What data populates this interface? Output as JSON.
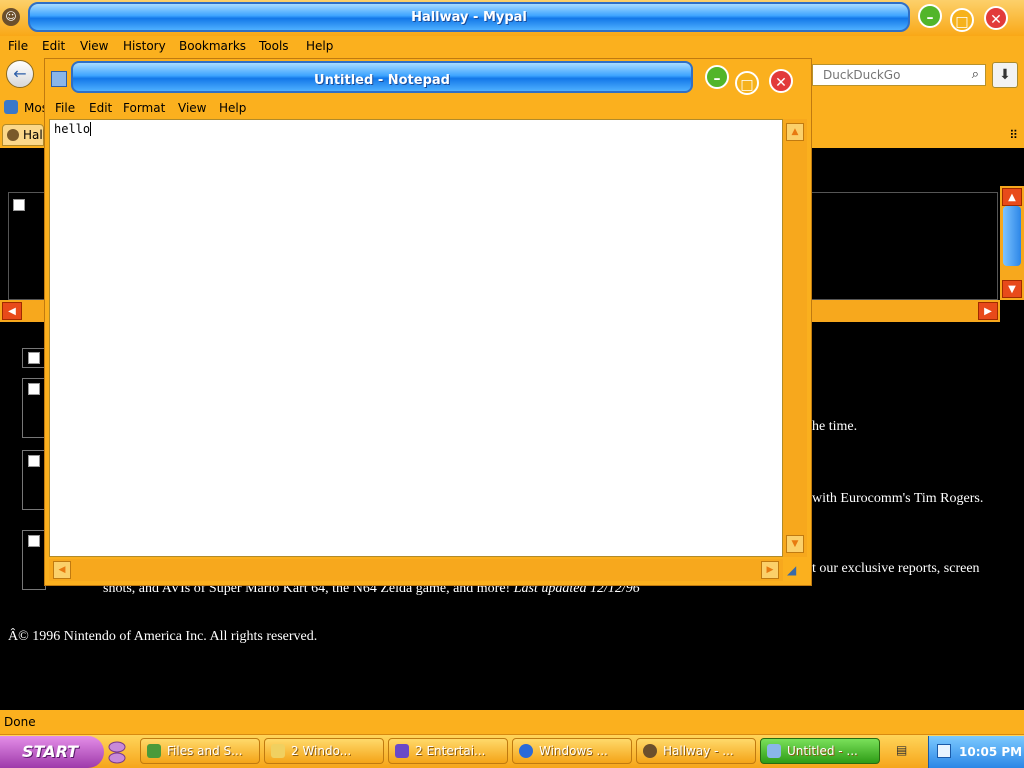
{
  "browser": {
    "title": "Hallway - Mypal",
    "menu": [
      "File",
      "Edit",
      "View",
      "History",
      "Bookmarks",
      "Tools",
      "Help"
    ],
    "search_placeholder": "DuckDuckGo",
    "bookmark_label": "Mos",
    "tab_label": "Hall",
    "status": "Done"
  },
  "page_text": {
    "fragment_time": "he time.",
    "fragment_tim": "with Eurocomm's Tim Rogers.",
    "fragment_reports": "t our exclusive reports, screen",
    "fragment_shots": "shots, and AVIs of Super Mario Kart 64, the N64 Zelda game, and more!",
    "fragment_updated": "Last updated 12/12/96",
    "copyright": "Â© 1996 Nintendo of America Inc. All rights reserved."
  },
  "notepad": {
    "title": "Untitled - Notepad",
    "menu": [
      "File",
      "Edit",
      "Format",
      "View",
      "Help"
    ],
    "content": "hello"
  },
  "taskbar": {
    "start_label": "START",
    "tasks": [
      {
        "label": "Files and S...",
        "icon_color": "#4a9a3a",
        "active": false
      },
      {
        "label": "2 Windo...",
        "icon_color": "#f0d060",
        "active": false
      },
      {
        "label": "2 Entertai...",
        "icon_color": "#6a4ac8",
        "active": false
      },
      {
        "label": "Windows ...",
        "icon_color": "#2a6ad8",
        "active": false
      },
      {
        "label": "Hallway - ...",
        "icon_color": "#6b4f2c",
        "active": false
      },
      {
        "label": "Untitled - ...",
        "icon_color": "#8ab6e8",
        "active": true
      }
    ],
    "clock": "10:05 PM"
  },
  "colors": {
    "window_orange": "#fbb01e",
    "titlebar_blue": "#1377e8",
    "start_purple": "#9e3aaa",
    "active_task_green": "#2e9c16"
  }
}
